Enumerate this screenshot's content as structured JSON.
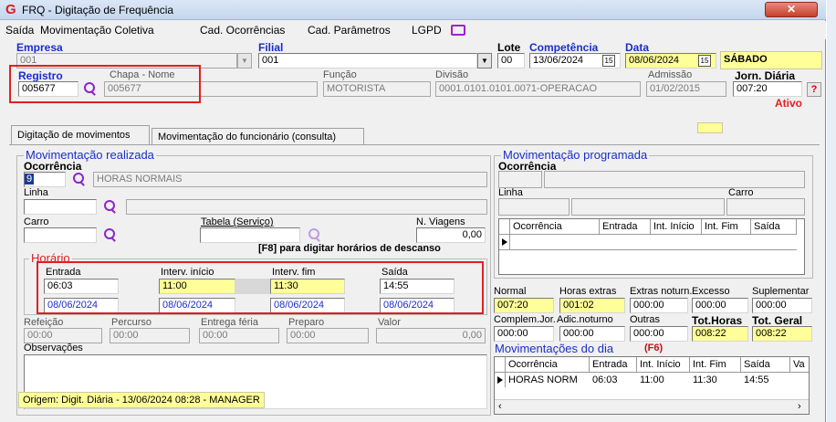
{
  "window": {
    "title": "FRQ - Digitação de Frequência",
    "close_label": "✕"
  },
  "menu": [
    "Saída",
    "Movimentação Coletiva",
    "Cad. Ocorrências",
    "Cad. Parâmetros",
    "LGPD"
  ],
  "header": {
    "empresa_label": "Empresa",
    "empresa_value": "001",
    "filial_label": "Filial",
    "filial_value": "001",
    "lote_label": "Lote",
    "lote_value": "00",
    "competencia_label": "Competência",
    "competencia_value": "13/06/2024",
    "data_label": "Data",
    "data_value": "08/06/2024",
    "dia_semana": "SÁBADO",
    "registro_label": "Registro",
    "registro_value": "005677",
    "chapa_label": "Chapa  -  Nome",
    "chapa_value": "005677",
    "funcao_label": "Função",
    "funcao_value": "MOTORISTA",
    "divisao_label": "Divisão",
    "divisao_value": "0001.0101.0101.0071-OPERACAO",
    "admissao_label": "Admissão",
    "admissao_value": "01/02/2015",
    "jornada_label": "Jorn. Diária",
    "jornada_value": "007:20",
    "status": "Ativo",
    "help": "?"
  },
  "tabs": [
    "Digitação de movimentos",
    "Movimentação do funcionário (consulta)"
  ],
  "realizada": {
    "title": "Movimentação realizada",
    "ocorrencia_label": "Ocorrência",
    "ocorrencia_code": "9",
    "ocorrencia_desc": "HORAS NORMAIS",
    "linha_label": "Linha",
    "carro_label": "Carro",
    "tabela_label": "Tabela (Serviço)",
    "viagens_label": "N. Viagens",
    "viagens_value": "0,00",
    "f8_hint": "[F8] para digitar horários de descanso",
    "horario_title": "Horário",
    "entrada_label": "Entrada",
    "entrada_value": "06:03",
    "entrada_date": "08/06/2024",
    "interv_inicio_label": "Interv. início",
    "interv_inicio_value": "11:00",
    "interv_inicio_date": "08/06/2024",
    "interv_fim_label": "Interv. fim",
    "interv_fim_value": "11:30",
    "interv_fim_date": "08/06/2024",
    "saida_label": "Saída",
    "saida_value": "14:55",
    "saida_date": "08/06/2024",
    "refeicao_label": "Refeição",
    "refeicao_value": "00:00",
    "percurso_label": "Percurso",
    "percurso_value": "00:00",
    "entrega_label": "Entrega féria",
    "entrega_value": "00:00",
    "preparo_label": "Preparo",
    "preparo_value": "00:00",
    "valor_label": "Valor",
    "valor_value": "0,00",
    "obs_label": "Observações",
    "origem": "Origem: Digit. Diária - 13/06/2024 08:28 - MANAGER"
  },
  "programada": {
    "title": "Movimentação programada",
    "ocorrencia_label": "Ocorrência",
    "linha_label": "Linha",
    "carro_label": "Carro",
    "columns": [
      "Ocorrência",
      "Entrada",
      "Int. Início",
      "Int. Fim",
      "Saída"
    ]
  },
  "totais": {
    "normal_label": "Normal",
    "normal_value": "007:20",
    "extras_label": "Horas extras",
    "extras_value": "001:02",
    "extras_noturn_label": "Extras noturn.",
    "extras_noturn_value": "000:00",
    "excesso_label": "Excesso",
    "excesso_value": "000:00",
    "suplementar_label": "Suplementar",
    "suplementar_value": "000:00",
    "complem_label": "Complem.Jor.",
    "complem_value": "000:00",
    "adic_label": "Adic.noturno",
    "adic_value": "000:00",
    "outras_label": "Outras",
    "outras_value": "000:00",
    "tot_horas_label": "Tot.Horas",
    "tot_horas_value": "008:22",
    "tot_geral_label": "Tot. Geral",
    "tot_geral_value": "008:22"
  },
  "mov_dia": {
    "title": "Movimentações do dia",
    "hotkey": "(F6)",
    "columns": [
      "Ocorrência",
      "Entrada",
      "Int. Início",
      "Int. Fim",
      "Saída",
      "Va"
    ],
    "rows": [
      [
        "HORAS NORM",
        "06:03",
        "11:00",
        "11:30",
        "14:55",
        ""
      ]
    ]
  }
}
